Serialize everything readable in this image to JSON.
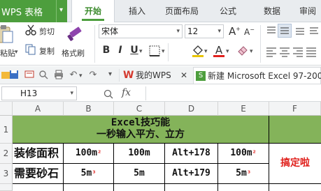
{
  "menubar": {
    "app_label": "WPS 表格",
    "tabs": [
      "开始",
      "插入",
      "页面布局",
      "公式",
      "数据",
      "审阅"
    ]
  },
  "ribbon": {
    "cut": "剪切",
    "paste_label": "粘贴",
    "copy": "复制",
    "format_painter": "格式刷",
    "font_name": "宋体",
    "font_size": "12",
    "bold": "B",
    "italic": "I",
    "underline": "U",
    "font_color_letter": "A",
    "grow_font": "A",
    "shrink_font": "A"
  },
  "quickbar": {
    "tab_wps": "我的WPS",
    "tab_doc": "新建 Microsoft Excel 97-200"
  },
  "formula": {
    "cell_ref": "H13",
    "fx": "fx",
    "value": ""
  },
  "sheet": {
    "columns": [
      "A",
      "B",
      "C",
      "D",
      "E",
      "F"
    ],
    "rows": [
      "1",
      "2",
      "3"
    ],
    "title_line1": "Excel技巧能",
    "title_line2": "一秒输入平方、立方",
    "r2": {
      "label": "装修面积",
      "b": "100m",
      "b_sup": "²",
      "c": "100m",
      "d": "Alt+178",
      "e": "100m",
      "e_sup": "²"
    },
    "r3": {
      "label": "需要砂石",
      "b": "5m",
      "b_sup": "³",
      "c": "5m",
      "d": "Alt+179",
      "e": "5m",
      "e_sup": "³"
    },
    "f_result": "搞定啦"
  },
  "colors": {
    "app_green": "#4d9e3d",
    "title_fill": "#84b35a",
    "highlight_red": "#e0211d"
  },
  "icons": [
    "scissors-icon",
    "paste-icon",
    "copy-icon",
    "format-painter-icon",
    "folder-icon",
    "save-icon",
    "print-icon",
    "undo-icon",
    "redo-icon",
    "search-icon"
  ]
}
